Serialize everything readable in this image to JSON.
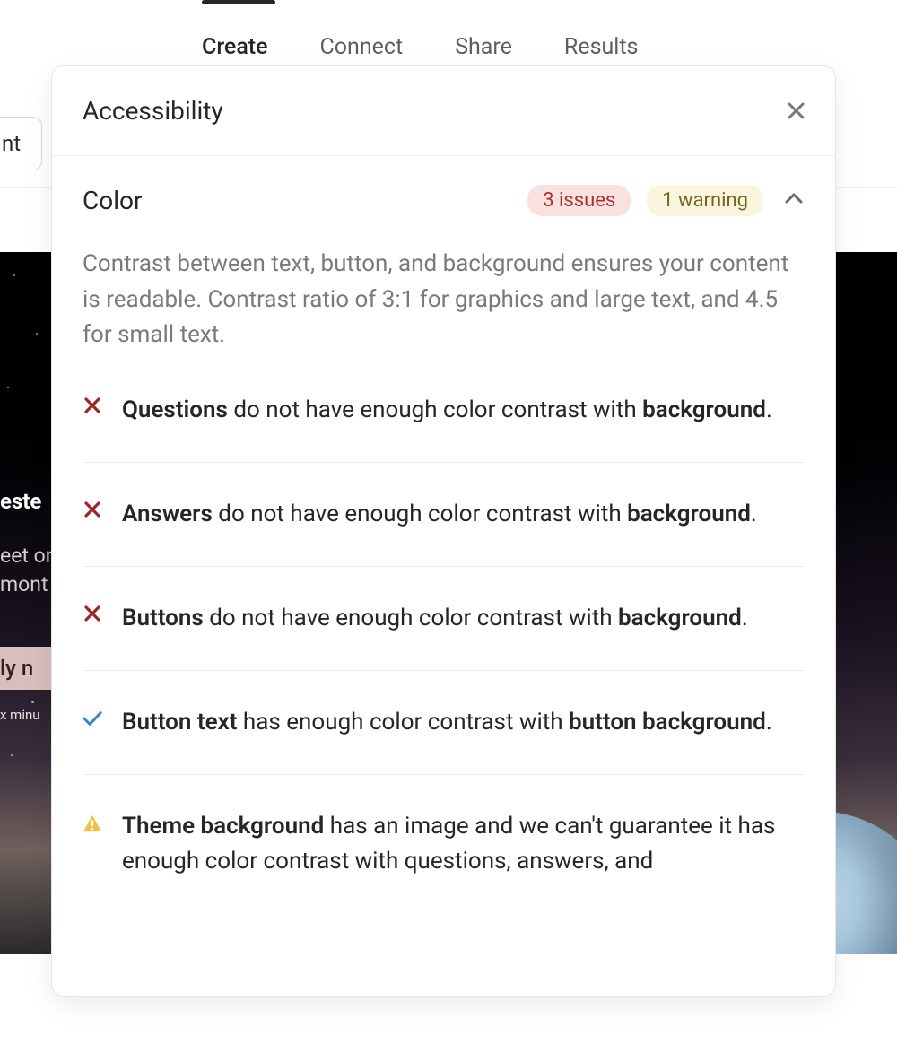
{
  "tabs": {
    "create": "Create",
    "connect": "Connect",
    "share": "Share",
    "results": "Results"
  },
  "fragments": {
    "nt": "nt",
    "este": "este",
    "eet_on": "eet on",
    "mont": "mont",
    "ly": "ly n",
    "minu": "x minu"
  },
  "panel": {
    "title": "Accessibility",
    "section_title": "Color",
    "issues_badge": "3 issues",
    "warning_badge": "1 warning",
    "description": "Contrast between text, button, and background ensures your content is readable. Contrast ratio of 3:1 for graphics and large text, and 4.5 for small text."
  },
  "items": [
    {
      "status": "error",
      "strong1": "Questions",
      "part1": " do not have enough color contrast with ",
      "strong2": "background",
      "part2": "."
    },
    {
      "status": "error",
      "strong1": "Answers",
      "part1": " do not have enough color contrast with ",
      "strong2": "background",
      "part2": "."
    },
    {
      "status": "error",
      "strong1": "Buttons",
      "part1": " do not have enough color contrast with ",
      "strong2": "background",
      "part2": "."
    },
    {
      "status": "ok",
      "strong1": "Button text",
      "part1": " has enough color contrast with ",
      "strong2": "button background",
      "part2": "."
    },
    {
      "status": "warning",
      "strong1": "Theme background",
      "part1": " has an image and we can't guarantee it has enough color contrast with questions, answers, and ",
      "strong2": "",
      "part2": ""
    }
  ]
}
